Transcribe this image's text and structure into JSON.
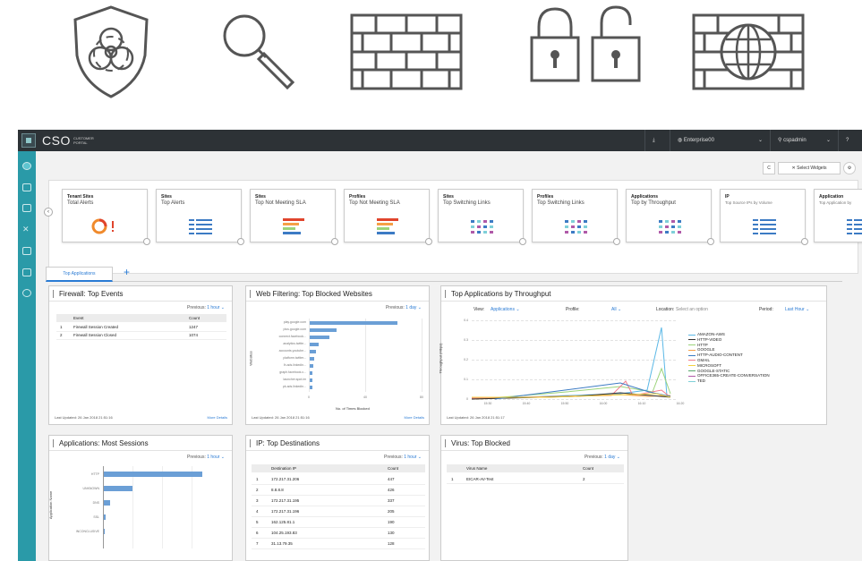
{
  "icons": [
    "biohazard-shield-icon",
    "magnifier-icon",
    "brick-wall-icon",
    "padlock-pair-icon",
    "globe-firewall-icon"
  ],
  "topbar": {
    "brand": "CSO",
    "brand_sub": "CUSTOMER PORTAL",
    "tenant": "Enterprise00",
    "user": "cspadmin",
    "help": "?"
  },
  "toolbar": {
    "refresh": "C",
    "select_widgets": "Select Widgets"
  },
  "cards": [
    {
      "l1": "Tenant Sites",
      "l2": "Total Alerts",
      "icon": "donut-alert-icon"
    },
    {
      "l1": "Sites",
      "l2": "Top Alerts",
      "icon": "list-icon"
    },
    {
      "l1": "Sites",
      "l2": "Top Not Meeting SLA",
      "icon": "bars-icon"
    },
    {
      "l1": "Profiles",
      "l2": "Top Not Meeting SLA",
      "icon": "bars-icon"
    },
    {
      "l1": "Sites",
      "l2": "Top Switching Links",
      "icon": "links-icon"
    },
    {
      "l1": "Profiles",
      "l2": "Top Switching Links",
      "icon": "links-icon"
    },
    {
      "l1": "Applications",
      "l2": "Top by Throughput",
      "icon": "links-icon"
    },
    {
      "l1": "IP",
      "l2": "Top Source IPs by Volume",
      "icon": "list-icon"
    },
    {
      "l1": "Application",
      "l2": "Top Application by",
      "icon": "list-icon"
    }
  ],
  "tab": {
    "label": "Top Applications",
    "plus": "+"
  },
  "firewall": {
    "title": "Firewall: Top Events",
    "prev_label": "Previous:",
    "prev_value": "1 hour",
    "col1": "Event",
    "col2": "Count",
    "rows": [
      {
        "n": "1",
        "event": "Firewall Session Created",
        "count": "1247"
      },
      {
        "n": "2",
        "event": "Firewall Session Closed",
        "count": "1074"
      }
    ],
    "updated": "Last Updated: 26 Jan 2018 21:51:16",
    "more": "More Details"
  },
  "webfilter": {
    "title": "Web Filtering: Top Blocked Websites",
    "prev_label": "Previous:",
    "prev_value": "1 day",
    "ylabel": "Websites",
    "xlabel": "No. of Times Blocked",
    "sites": [
      "play.google.com",
      "plus.google.com",
      "connect.facebook...",
      "analytics.twitte...",
      "accounts.youtube...",
      "platform.twitter...",
      "lh.ads.linkedin...",
      "graph.facebook.c...",
      "launcher.spot.im",
      "pk.ads.linkedin..."
    ],
    "ticks": [
      "0",
      "40",
      "80"
    ],
    "updated": "Last Updated: 26 Jan 2018 21:51:16",
    "more": "More Details"
  },
  "throughput": {
    "title": "Top Applications by Throughput",
    "view_label": "View:",
    "view_value": "Applications",
    "profile_label": "Profile:",
    "profile_value": "All",
    "location_label": "Location:",
    "location_value": "Select an option",
    "period_label": "Period:",
    "period_value": "Last Hour",
    "ylabel": "Throughput (Mbps)",
    "yticks": [
      "0.4",
      "0.3",
      "0.2",
      "0.1",
      "0"
    ],
    "xticks": [
      "15:30",
      "15:40",
      "15:50",
      "16:00",
      "16:10",
      "16:20"
    ],
    "updated": "Last Updated: 26 Jan 2018 21:51:17",
    "legend": [
      {
        "name": "AMAZON-AWS",
        "color": "#5bb8e6"
      },
      {
        "name": "HTTP-VIDEO",
        "color": "#333333"
      },
      {
        "name": "HTTP",
        "color": "#9bd37a"
      },
      {
        "name": "GOOGLE",
        "color": "#f5a046"
      },
      {
        "name": "HTTP-AUDIO-CONTENT",
        "color": "#3c7bc4"
      },
      {
        "name": "GMAIL",
        "color": "#f27c8d"
      },
      {
        "name": "MICROSOFT",
        "color": "#f5d240"
      },
      {
        "name": "GOOGLE-STATIC",
        "color": "#57a66b"
      },
      {
        "name": "OFFICE365-CREATE-CONVERSATION",
        "color": "#b05aa8"
      },
      {
        "name": "TED",
        "color": "#7fd0d8"
      }
    ]
  },
  "appsessions": {
    "title": "Applications: Most Sessions",
    "prev_label": "Previous:",
    "prev_value": "1 hour",
    "ylabel": "Application Name",
    "apps": [
      "HTTP",
      "UNKNOWN",
      "DNS",
      "SSL",
      "INCONCLUSIVE"
    ]
  },
  "ipdest": {
    "title": "IP: Top Destinations",
    "prev_label": "Previous:",
    "prev_value": "1 hour",
    "col1": "Destination IP",
    "col2": "Count",
    "rows": [
      {
        "n": "1",
        "ip": "172.217.31.206",
        "count": "447"
      },
      {
        "n": "2",
        "ip": "8.8.8.8",
        "count": "426"
      },
      {
        "n": "3",
        "ip": "172.217.31.195",
        "count": "337"
      },
      {
        "n": "4",
        "ip": "172.217.31.196",
        "count": "205"
      },
      {
        "n": "5",
        "ip": "162.125.81.1",
        "count": "190"
      },
      {
        "n": "6",
        "ip": "104.25.193.83",
        "count": "130"
      },
      {
        "n": "7",
        "ip": "31.13.79.35",
        "count": "128"
      }
    ]
  },
  "virus": {
    "title": "Virus: Top Blocked",
    "prev_label": "Previous:",
    "prev_value": "1 day",
    "col1": "Virus Name",
    "col2": "Count",
    "rows": [
      {
        "n": "1",
        "name": "EICAR-AV-Test",
        "count": "2"
      }
    ]
  }
}
